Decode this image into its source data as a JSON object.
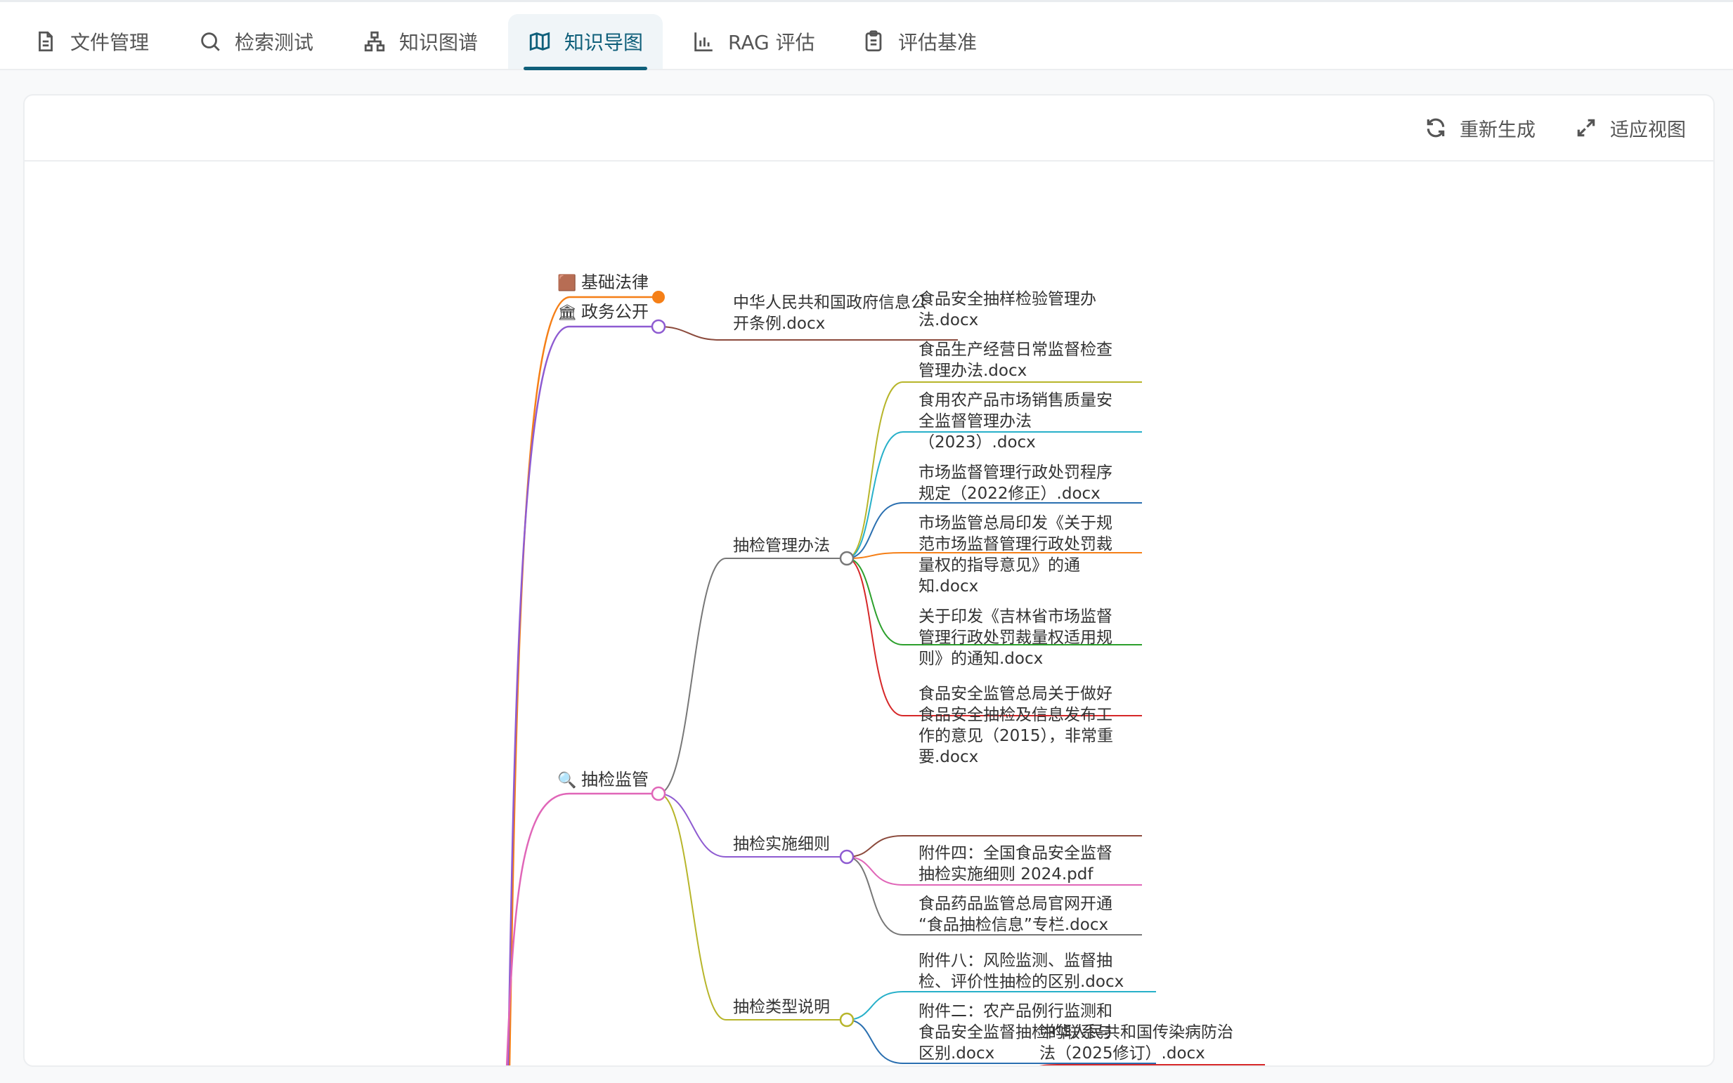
{
  "tabs": [
    {
      "label": "文件管理",
      "icon": "file-icon"
    },
    {
      "label": "检索测试",
      "icon": "search-icon"
    },
    {
      "label": "知识图谱",
      "icon": "network-icon"
    },
    {
      "label": "知识导图",
      "icon": "map-icon"
    },
    {
      "label": "RAG 评估",
      "icon": "bar-chart-icon"
    },
    {
      "label": "评估基准",
      "icon": "clipboard-icon"
    }
  ],
  "active_tab": 3,
  "toolbar": {
    "regenerate_label": "重新生成",
    "fit_view_label": "适应视图"
  },
  "mindmap": {
    "branches": [
      {
        "id": "b1",
        "emoji": "🟫",
        "label": "基础法律",
        "color": "#f57f17"
      },
      {
        "id": "b2",
        "emoji": "🏛",
        "label": "政务公开",
        "color": "#8e5bd1"
      },
      {
        "id": "b3",
        "emoji": "🔍",
        "label": "抽检监管",
        "color": "#e066b8"
      }
    ],
    "nodes": {
      "gov_doc": [
        "中华人民共和国政府信息公",
        "开条例.docx"
      ],
      "sub1": "抽检管理办法",
      "sub2": "抽检实施细则",
      "sub3": "抽检类型说明",
      "l1": [
        "食品安全抽样检验管理办",
        "法.docx"
      ],
      "l2": [
        "食品生产经营日常监督检查",
        "管理办法.docx"
      ],
      "l3": [
        "食用农产品市场销售质量安",
        "全监督管理办法",
        "（2023）.docx"
      ],
      "l4": [
        "市场监督管理行政处罚程序",
        "规定（2022修正）.docx"
      ],
      "l5": [
        "市场监管总局印发《关于规",
        "范市场监督管理行政处罚裁",
        "量权的指导意见》的通",
        "知.docx"
      ],
      "l6": [
        "关于印发《吉林省市场监督",
        "管理行政处罚裁量权适用规",
        "则》的通知.docx"
      ],
      "l7": [
        "食品安全监管总局关于做好",
        "食品安全抽检及信息发布工",
        "作的意见（2015），非常重",
        "要.docx"
      ],
      "l8": [
        "附件四：全国食品安全监督",
        "抽检实施细则 2024.pdf"
      ],
      "l9": [
        "食品药品监管总局官网开通",
        "“食品抽检信息”专栏.docx"
      ],
      "l10": [
        "附件八：风险监测、监督抽",
        "检、评价性抽检的区别.docx"
      ],
      "l11": [
        "附件二：农产品例行监测和",
        "食品安全监督抽检的联系与",
        "区别.docx"
      ],
      "l12": [
        "中华人民共和国传染病防治",
        "法（2025修订）.docx"
      ]
    }
  }
}
